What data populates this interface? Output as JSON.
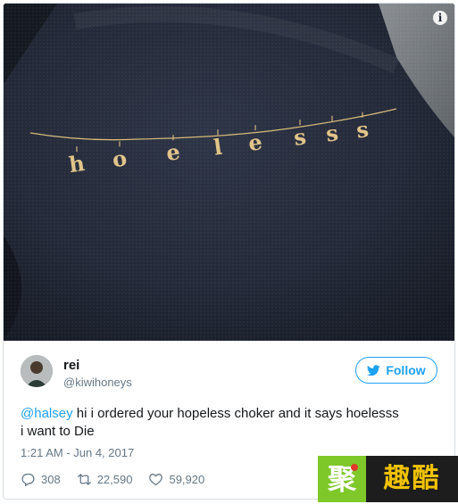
{
  "tweet": {
    "display_name": "rei",
    "handle": "@kiwihoneys",
    "follow_label": "Follow",
    "mention": "@halsey",
    "text_line1": " hi i ordered your hopeless choker and it says hoelesss",
    "text_line2": "i want to Die",
    "timestamp": "1:21 AM - Jun 4, 2017",
    "replies": "308",
    "retweets": "22,590",
    "likes": "59,920"
  },
  "media": {
    "info_icon": "info-icon",
    "necklace_letters": [
      "h",
      "o",
      "e",
      "l",
      "e",
      "s",
      "s",
      "s"
    ]
  },
  "watermark": {
    "left_text": "聚",
    "right_text": "趣酷"
  },
  "colors": {
    "accent": "#1da1f2",
    "text": "#14171a",
    "muted": "#657786",
    "watermark_green": "#7ec82a",
    "watermark_dark": "#1d1d1d",
    "watermark_yellow": "#f2c200"
  }
}
